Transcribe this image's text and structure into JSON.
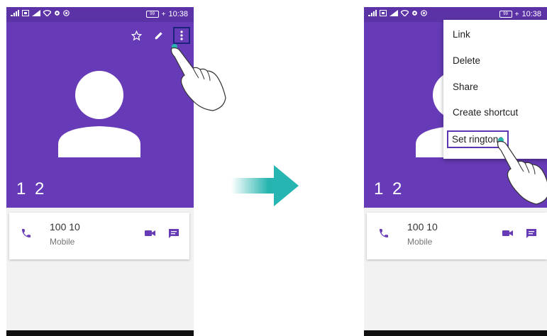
{
  "left_screen": {
    "status": {
      "time": "10:38",
      "battery": "99",
      "charging": "+"
    },
    "toolbar": {
      "icons": [
        "star-outline-icon",
        "edit-pencil-icon",
        "more-vertical-icon"
      ]
    },
    "contact_name": "1 2",
    "phone_entry": {
      "number": "100 10",
      "type": "Mobile"
    }
  },
  "right_screen": {
    "status": {
      "time": "10:38",
      "battery": "99",
      "charging": "+"
    },
    "contact_name": "1 2",
    "phone_entry": {
      "number": "100 10",
      "type": "Mobile"
    },
    "menu": {
      "items": [
        {
          "label": "Link"
        },
        {
          "label": "Delete"
        },
        {
          "label": "Share"
        },
        {
          "label": "Create shortcut"
        },
        {
          "label": "Set ringtone",
          "selected": true
        }
      ]
    }
  },
  "colors": {
    "header": "#673ab7",
    "accent": "#673ab7",
    "highlight": "#1a237e",
    "arrow": "#26b5b0"
  }
}
